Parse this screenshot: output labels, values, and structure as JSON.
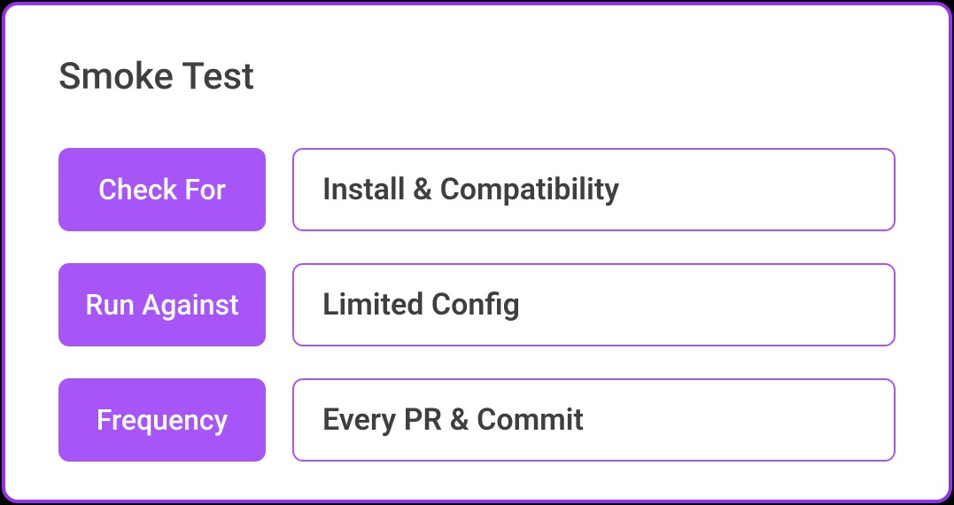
{
  "card": {
    "title": "Smoke Test",
    "rows": [
      {
        "label": "Check For",
        "value": "Install & Compatibility"
      },
      {
        "label": "Run Against",
        "value": "Limited Config"
      },
      {
        "label": "Frequency",
        "value": "Every PR & Commit"
      }
    ]
  },
  "colors": {
    "accent": "#a855f7",
    "border": "#9333ea",
    "text": "#3f3f3f"
  }
}
